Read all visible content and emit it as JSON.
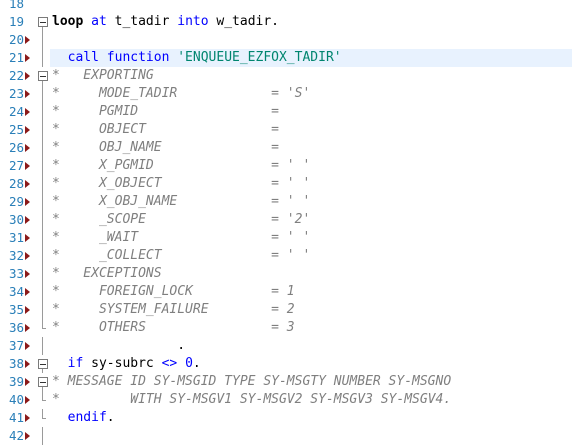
{
  "lines": [
    {
      "n": "18",
      "m": false,
      "f": "none",
      "code": []
    },
    {
      "n": "19",
      "m": false,
      "f": "box",
      "code": [
        {
          "t": "loop",
          "c": "kw-b"
        },
        {
          "t": " "
        },
        {
          "t": "at",
          "c": "kw"
        },
        {
          "t": " t_tadir "
        },
        {
          "t": "into",
          "c": "kw"
        },
        {
          "t": " w_tadir."
        }
      ]
    },
    {
      "n": "20",
      "m": true,
      "f": "line",
      "code": []
    },
    {
      "n": "21",
      "m": true,
      "f": "line",
      "hl": true,
      "code": [
        {
          "t": "  "
        },
        {
          "t": "call function",
          "c": "kw"
        },
        {
          "t": " "
        },
        {
          "t": "'ENQUEUE_EZFOX_TADIR'",
          "c": "str"
        }
      ]
    },
    {
      "n": "22",
      "m": true,
      "f": "box",
      "code": [
        {
          "t": "*   EXPORTING",
          "c": "cmt"
        }
      ]
    },
    {
      "n": "23",
      "m": true,
      "f": "line",
      "code": [
        {
          "t": "*     MODE_TADIR            = 'S'",
          "c": "cmt"
        }
      ]
    },
    {
      "n": "24",
      "m": true,
      "f": "line",
      "code": [
        {
          "t": "*     PGMID                 =",
          "c": "cmt"
        }
      ]
    },
    {
      "n": "25",
      "m": true,
      "f": "line",
      "code": [
        {
          "t": "*     OBJECT                =",
          "c": "cmt"
        }
      ]
    },
    {
      "n": "26",
      "m": true,
      "f": "line",
      "code": [
        {
          "t": "*     OBJ_NAME              =",
          "c": "cmt"
        }
      ]
    },
    {
      "n": "27",
      "m": true,
      "f": "line",
      "code": [
        {
          "t": "*     X_PGMID               = ' '",
          "c": "cmt"
        }
      ]
    },
    {
      "n": "28",
      "m": true,
      "f": "line",
      "code": [
        {
          "t": "*     X_OBJECT              = ' '",
          "c": "cmt"
        }
      ]
    },
    {
      "n": "29",
      "m": true,
      "f": "line",
      "code": [
        {
          "t": "*     X_OBJ_NAME            = ' '",
          "c": "cmt"
        }
      ]
    },
    {
      "n": "30",
      "m": true,
      "f": "line",
      "code": [
        {
          "t": "*     _SCOPE                = '2'",
          "c": "cmt"
        }
      ]
    },
    {
      "n": "31",
      "m": true,
      "f": "line",
      "code": [
        {
          "t": "*     _WAIT                 = ' '",
          "c": "cmt"
        }
      ]
    },
    {
      "n": "32",
      "m": true,
      "f": "line",
      "code": [
        {
          "t": "*     _COLLECT              = ' '",
          "c": "cmt"
        }
      ]
    },
    {
      "n": "33",
      "m": true,
      "f": "line",
      "code": [
        {
          "t": "*   EXCEPTIONS",
          "c": "cmt"
        }
      ]
    },
    {
      "n": "34",
      "m": true,
      "f": "line",
      "code": [
        {
          "t": "*     FOREIGN_LOCK          = 1",
          "c": "cmt"
        }
      ]
    },
    {
      "n": "35",
      "m": true,
      "f": "line",
      "code": [
        {
          "t": "*     SYSTEM_FAILURE        = 2",
          "c": "cmt"
        }
      ]
    },
    {
      "n": "36",
      "m": true,
      "f": "end",
      "code": [
        {
          "t": "*     OTHERS                = 3",
          "c": "cmt"
        }
      ]
    },
    {
      "n": "37",
      "m": true,
      "f": "line",
      "code": [
        {
          "t": "                ."
        }
      ]
    },
    {
      "n": "38",
      "m": true,
      "f": "box",
      "code": [
        {
          "t": "  "
        },
        {
          "t": "if",
          "c": "kw"
        },
        {
          "t": " sy-subrc "
        },
        {
          "t": "<>",
          "c": "kw"
        },
        {
          "t": " "
        },
        {
          "t": "0",
          "c": "num"
        },
        {
          "t": "."
        }
      ]
    },
    {
      "n": "39",
      "m": true,
      "f": "box",
      "code": [
        {
          "t": "* MESSAGE ID SY-MSGID TYPE SY-MSGTY NUMBER SY-MSGNO",
          "c": "cmt"
        }
      ]
    },
    {
      "n": "40",
      "m": true,
      "f": "end",
      "code": [
        {
          "t": "*         WITH SY-MSGV1 SY-MSGV2 SY-MSGV3 SY-MSGV4.",
          "c": "cmt"
        }
      ]
    },
    {
      "n": "41",
      "m": true,
      "f": "end",
      "code": [
        {
          "t": "  "
        },
        {
          "t": "endif",
          "c": "kw"
        },
        {
          "t": "."
        }
      ]
    },
    {
      "n": "42",
      "m": true,
      "f": "line",
      "code": []
    }
  ],
  "colors": {
    "keyword": "#0000ff",
    "string": "#00856f",
    "comment": "#7f7f7f",
    "line_number": "#2a7fb8",
    "marker": "#8b1a1a",
    "highlight": "#e8f2fe"
  }
}
